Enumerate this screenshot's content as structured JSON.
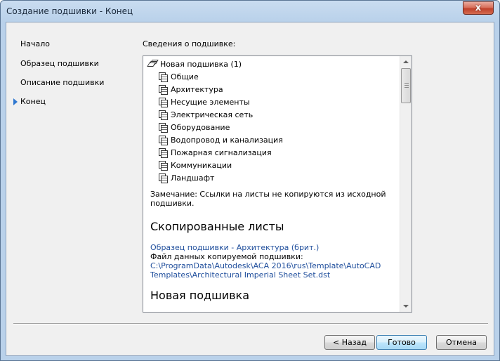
{
  "window": {
    "title": "Создание подшивки - Конец",
    "close_glyph": "x"
  },
  "nav": {
    "items": [
      {
        "label": "Начало"
      },
      {
        "label": "Образец подшивки"
      },
      {
        "label": "Описание подшивки"
      },
      {
        "label": "Конец",
        "current": true
      }
    ]
  },
  "details": {
    "label": "Сведения о подшивке:",
    "root": "Новая подшивка (1)",
    "subsets": [
      "Общие",
      "Архитектура",
      "Несущие элементы",
      "Электрическая сеть",
      "Оборудование",
      "Водопровод и канализация",
      "Пожарная сигнализация",
      "Коммуникации",
      "Ландшафт"
    ],
    "note_line1": "Замечание: Ссылки на листы не копируются из исходной",
    "note_line2": "подшивки.",
    "copied_heading": "Скопированные листы",
    "template_link": "Образец подшивки - Архитектура (брит.)",
    "data_file_label": "Файл данных копируемой подшивки:",
    "data_file_path_line1": "C:\\ProgramData\\Autodesk\\ACA 2016\\rus\\Template\\AutoCAD",
    "data_file_path_line2": "Templates\\Architectural Imperial Sheet Set.dst",
    "new_heading": "Новая подшивка"
  },
  "buttons": {
    "back": "< Назад",
    "finish": "Готово",
    "cancel": "Отмена"
  },
  "colors": {
    "link": "#1f4e9c",
    "nav_arrow": "#2e77d0",
    "close_button": "#c0412b"
  }
}
